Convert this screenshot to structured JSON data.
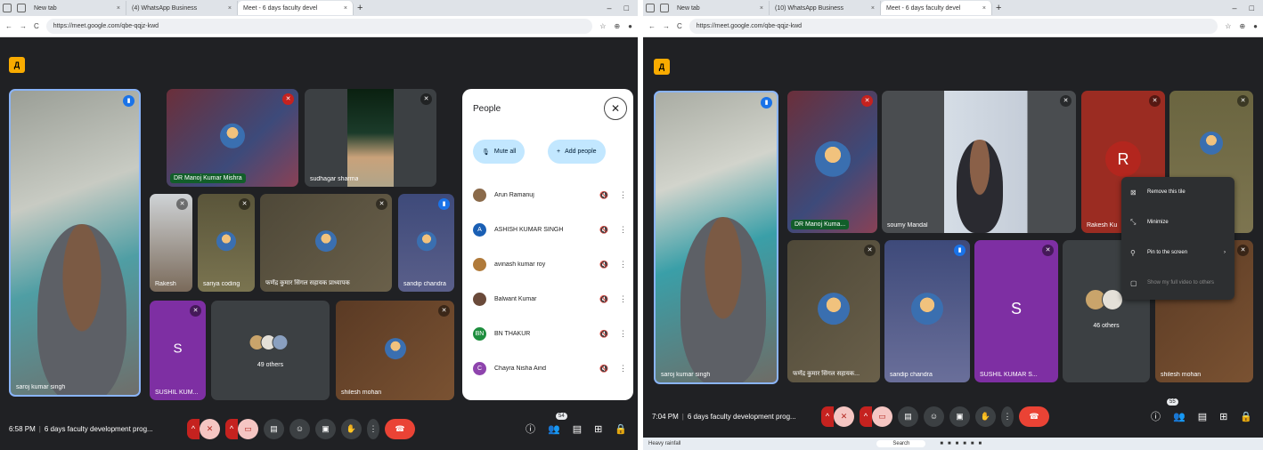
{
  "colors": {
    "meet_bg": "#202124",
    "tile_bg": "#3c4043",
    "hangup": "#ea4335",
    "panel_button": "#c2e7ff",
    "logo": "#f9ab00"
  },
  "left": {
    "tabs": [
      {
        "label": "New tab"
      },
      {
        "label": "(4) WhatsApp Business"
      },
      {
        "label": "Meet - 6 days faculty devel"
      }
    ],
    "url": "https://meet.google.com/qbe-qqjz-kwd",
    "tiles": [
      {
        "name": "saroj kumar singh"
      },
      {
        "name": "DR Manoj Kumar Mishra"
      },
      {
        "name": "sudhagar sharma"
      },
      {
        "name": "Rakesh"
      },
      {
        "name": "sariya coding"
      },
      {
        "name": "फणेंद्र कुमार सिंगल सहायक प्राध्यापक"
      },
      {
        "name": "sandip chandra"
      },
      {
        "name": "SUSHIL KUM...",
        "letter": "S"
      },
      {
        "name": "",
        "others": "49 others"
      },
      {
        "name": "shilesh mohan"
      }
    ],
    "time": "6:58 PM",
    "meeting": "6 days faculty development prog...",
    "people_badge": "54",
    "people": {
      "title": "People",
      "mute_all": "Mute all",
      "add_people": "Add people",
      "list": [
        {
          "name": "Arun Ramanuj"
        },
        {
          "name": "ASHISH KUMAR SINGH",
          "letter": "A"
        },
        {
          "name": "avinash kumar roy"
        },
        {
          "name": "Balwant Kumar"
        },
        {
          "name": "BN THAKUR",
          "letter": "BN"
        },
        {
          "name": "Chayra Nisha Aind",
          "letter": "C"
        }
      ]
    }
  },
  "right": {
    "tabs": [
      {
        "label": "New tab"
      },
      {
        "label": "(10) WhatsApp Business"
      },
      {
        "label": "Meet - 6 days faculty devel"
      }
    ],
    "url": "https://meet.google.com/qbe-qqjz-kwd",
    "tiles": [
      {
        "name": "saroj kumar singh"
      },
      {
        "name": "DR Manoj Kuma..."
      },
      {
        "name": "soumy Mandal"
      },
      {
        "name": "Rakesh Ku",
        "letter": "R"
      },
      {
        "name": ""
      },
      {
        "name": "फणेंद्र कुमार सिंगल सहायक..."
      },
      {
        "name": "sandip chandra"
      },
      {
        "name": "SUSHIL KUMAR S...",
        "letter": "S"
      },
      {
        "name": "",
        "others": "46 others"
      },
      {
        "name": "shilesh mohan"
      }
    ],
    "time": "7:04 PM",
    "meeting": "6 days faculty development prog...",
    "people_badge": "55",
    "menu": [
      {
        "label": "Remove this tile",
        "icon": "remove-tile-icon"
      },
      {
        "label": "Minimize",
        "icon": "minimize-icon"
      },
      {
        "label": "Pin to the screen",
        "icon": "pin-icon"
      },
      {
        "label": "Show my full video to others",
        "icon": "full-video-icon"
      }
    ],
    "taskbar": {
      "search": "Search",
      "weather": "Heavy rainfall"
    }
  }
}
